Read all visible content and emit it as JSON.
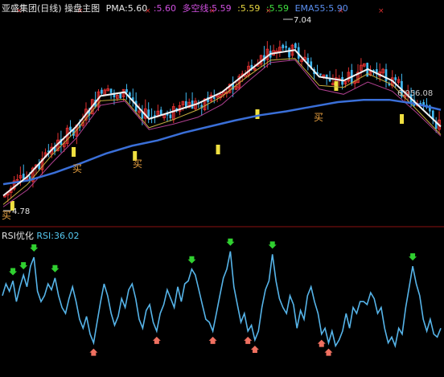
{
  "header": {
    "title": "亚盛集团(日线) 操盘主图",
    "pma": "PMA:5.60",
    "v2": ":5.60",
    "duokong": "多空线:5.59",
    "v4": ":5.59",
    "v5": ":5.59",
    "ema": "EMA55:5.90"
  },
  "rsi_header": {
    "name": "RSI优化",
    "value": "RSI:36.02"
  },
  "annotations": {
    "high": "7.04",
    "low": "4.78",
    "mid": "6.05",
    "mid2": "6.08",
    "buy": "买"
  },
  "colors": {
    "up": "#e03030",
    "down": "#40b8f0",
    "white_line": "#f2f2f2",
    "ema_line": "#3a6fd8",
    "rsi_line": "#56b4e9",
    "buy_text": "#e8a040",
    "marker_yellow": "#f0e040",
    "green_arrow": "#30d030",
    "red_arrow": "#f07060"
  },
  "chart_data": [
    {
      "type": "candlestick",
      "title": "亚盛集团(日线) 操盘主图",
      "price_range": [
        4.6,
        7.2
      ],
      "ema55": [
        5.05,
        5.1,
        5.2,
        5.32,
        5.45,
        5.55,
        5.62,
        5.72,
        5.8,
        5.88,
        5.95,
        6.0,
        6.06,
        6.12,
        6.15,
        6.15,
        6.1,
        6.02
      ],
      "pma": [
        4.9,
        5.15,
        5.5,
        5.8,
        6.2,
        6.25,
        5.9,
        6.0,
        6.1,
        6.25,
        6.5,
        6.75,
        6.8,
        6.45,
        6.4,
        6.55,
        6.4,
        6.1,
        5.8
      ],
      "annotations": [
        {
          "label": "7.04",
          "at": "high"
        },
        {
          "label": "4.78",
          "at": "low"
        },
        {
          "label": "6.05  6.08",
          "at": "right"
        }
      ],
      "buy_signals": 5
    },
    {
      "type": "line",
      "title": "RSI优化",
      "series": [
        {
          "name": "RSI:36.02",
          "values": [
            52,
            60,
            55,
            62,
            48,
            58,
            66,
            58,
            72,
            78,
            55,
            48,
            52,
            60,
            56,
            64,
            52,
            44,
            40,
            50,
            58,
            48,
            36,
            30,
            38,
            26,
            20,
            34,
            48,
            60,
            52,
            40,
            32,
            38,
            50,
            44,
            56,
            60,
            50,
            36,
            30,
            42,
            46,
            34,
            28,
            40,
            46,
            56,
            50,
            44,
            58,
            48,
            60,
            62,
            70,
            66,
            56,
            46,
            36,
            34,
            28,
            40,
            52,
            64,
            70,
            82,
            58,
            46,
            34,
            40,
            28,
            32,
            22,
            28,
            44,
            56,
            62,
            80,
            62,
            50,
            44,
            40,
            52,
            46,
            30,
            42,
            36,
            52,
            58,
            48,
            40,
            26,
            30,
            20,
            28,
            18,
            22,
            28,
            40,
            30,
            44,
            40,
            48,
            48,
            46,
            54,
            50,
            40,
            44,
            30,
            20,
            24,
            18,
            30,
            26,
            44,
            58,
            72,
            60,
            52,
            36,
            28,
            36,
            26,
            24,
            30
          ]
        }
      ],
      "ylim": [
        10,
        90
      ],
      "buy_arrows": 7,
      "sell_arrows": 9
    }
  ]
}
